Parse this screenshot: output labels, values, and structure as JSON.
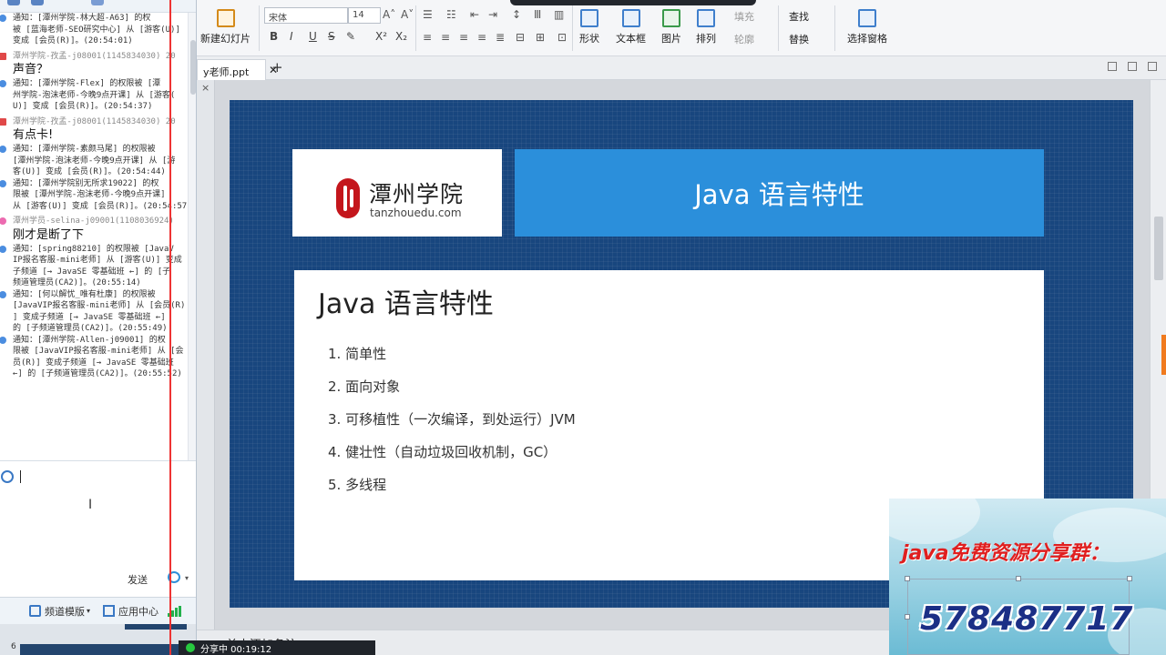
{
  "colors": {
    "slide_bg": "#18467e",
    "title_box": "#2b8fdb",
    "accent_red": "#e01f1f",
    "qq_number": "#1b2f86"
  },
  "chat": {
    "messages": [
      {
        "type": "notice",
        "icon": "info-icon",
        "lines": [
          "通知：[潭州学院-林大超-A63] 的权",
          "被 [蓝海老师-SEO研究中心] 从 [游客(U)]",
          "变成 [会员(R)]。(20:54:01)"
        ]
      },
      {
        "type": "sender",
        "icon": "gift-icon",
        "text": "潭州学院-孜孟-j08001(1145834030) 20"
      },
      {
        "type": "speech",
        "text": "声音？"
      },
      {
        "type": "notice",
        "icon": "info-icon",
        "lines": [
          "通知：[潭州学院-Flex] 的权限被 [潭",
          "州学院-泡沫老师-今晚9点开课] 从 [游客(",
          "U)] 变成 [会员(R)]。(20:54:37)"
        ]
      },
      {
        "type": "sender",
        "icon": "gift-icon",
        "text": "潭州学院-孜孟-j08001(1145834030) 20"
      },
      {
        "type": "speech",
        "text": "有点卡!"
      },
      {
        "type": "notice",
        "icon": "info-icon",
        "lines": [
          "通知：[潭州学院-素颜马尾] 的权限被",
          "[潭州学院-泡沫老师-今晚9点开课] 从 [游",
          "客(U)] 变成 [会员(R)]。(20:54:44)"
        ]
      },
      {
        "type": "notice",
        "icon": "info-icon",
        "lines": [
          "通知：[潭州学院别无所求19022] 的权",
          "限被 [潭州学院-泡沫老师-今晚9点开课]",
          "从 [游客(U)] 变成 [会员(R)]。(20:54:57"
        ]
      },
      {
        "type": "sender",
        "icon": "pink-user-icon",
        "text": "潭州学员-selina-j09001(1108036924)"
      },
      {
        "type": "speech",
        "text": "刚才是断了下"
      },
      {
        "type": "notice",
        "icon": "info-icon",
        "lines": [
          "通知：[spring88210] 的权限被 [JavaV",
          "IP报名客服-mini老师] 从 [游客(U)] 变成",
          "子频道 [→ JavaSE 零基础班 ←] 的 [子",
          "频道管理员(CA2)]。(20:55:14)"
        ]
      },
      {
        "type": "notice",
        "icon": "info-icon",
        "lines": [
          "通知：[何以解忧_唯有杜康] 的权限被",
          "[JavaVIP报名客服-mini老师] 从 [会员(R)",
          "] 变成子频道 [→ JavaSE 零基础班 ←]",
          "的 [子频道管理员(CA2)]。(20:55:49)"
        ]
      },
      {
        "type": "notice",
        "icon": "info-icon",
        "lines": [
          "通知：[潭州学院-Allen-j09001] 的权",
          "限被 [JavaVIP报名客服-mini老师] 从 [会",
          "员(R)] 变成子频道 [→ JavaSE 零基础班",
          "←] 的 [子频道管理员(CA2)]。(20:55:52)"
        ]
      }
    ],
    "send_label": "发送",
    "bottom": {
      "channel_mode": "频道模版",
      "app_center": "应用中心"
    },
    "foot_num": "6"
  },
  "ribbon": {
    "new_slide": "新建幻灯片",
    "font_name": "宋体",
    "font_size": "14",
    "bold": "B",
    "italic": "I",
    "underline": "U",
    "strike": "S",
    "superscript": "X²",
    "subscript": "X₂",
    "shape": "形状",
    "textbox": "文本框",
    "picture": "图片",
    "arrange": "排列",
    "fill": "填充",
    "outline": "轮廓",
    "find": "查找",
    "replace": "替换",
    "select_pane": "选择窗格"
  },
  "tab": {
    "doc_name": "y老师.ppt",
    "close": "✕",
    "add": "+"
  },
  "slide": {
    "logo_cn": "潭州学院",
    "logo_en": "tanzhouedu.com",
    "title": "Java 语言特性",
    "content_title": "Java 语言特性",
    "items": [
      "1. 简单性",
      "2. 面向对象",
      "3. 可移植性（一次编译，到处运行）JVM",
      "4. 健壮性（自动垃圾回收机制，GC）",
      "5. 多线程"
    ]
  },
  "notes": {
    "placeholder": "单击添加备注"
  },
  "share": {
    "label": "分享中 00:19:12"
  },
  "overlay": {
    "text": "java免费资源分享群：",
    "qq": "578487717"
  }
}
